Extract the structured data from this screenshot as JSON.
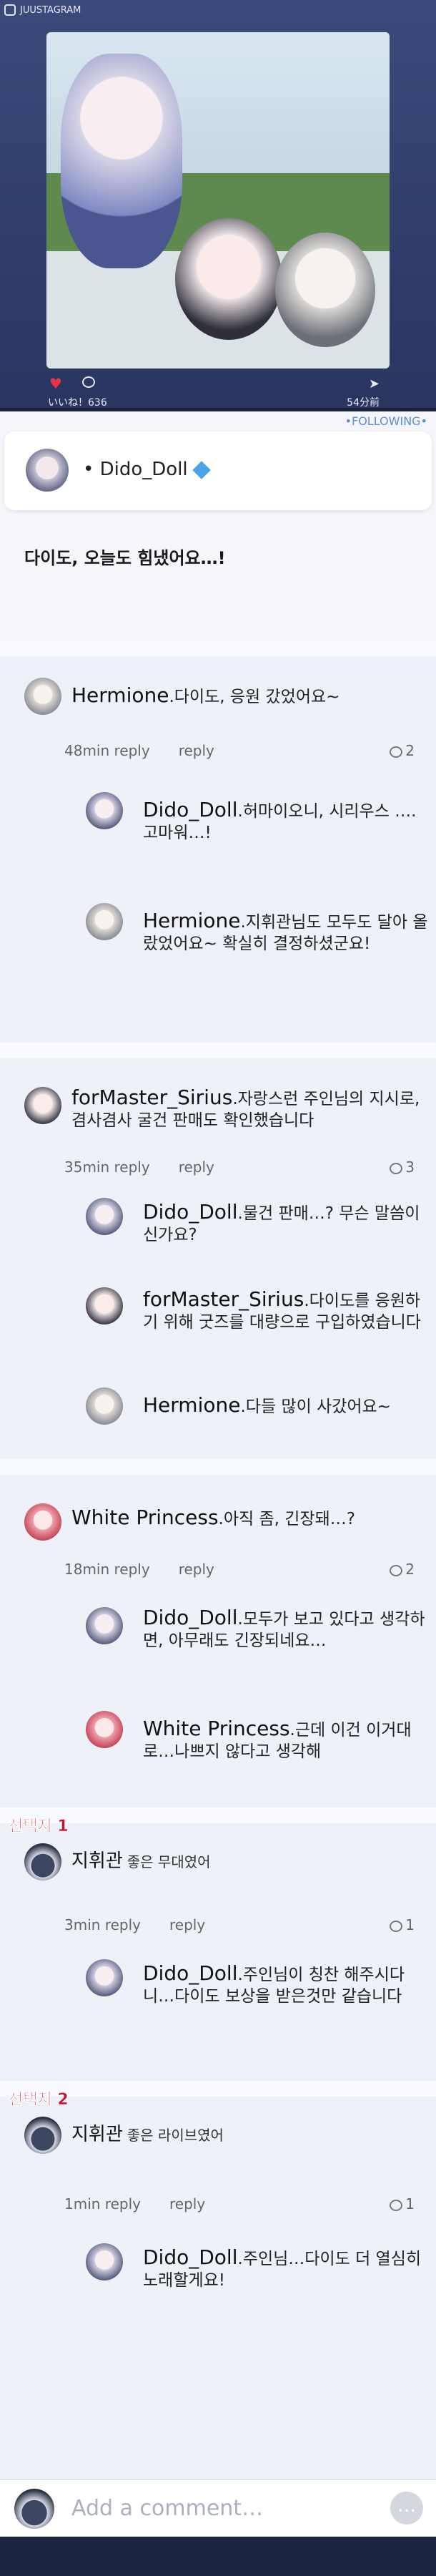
{
  "app": {
    "brand": "JUUSTAGRAM"
  },
  "post": {
    "likes": "いいね！636",
    "time": "54分前",
    "following": "•FOLLOWING•",
    "author": "Dido_Doll",
    "caption": "다이도, 오늘도 힘냈어요…!"
  },
  "threads": [
    {
      "author": "Hermione",
      "text": "다이도, 응원 갔었어요~",
      "time": "48min reply",
      "reply": "reply",
      "count": "2",
      "replies": [
        {
          "author": "Dido_Doll",
          "text": "허마이오니, 시리우스 ….고마워…!"
        },
        {
          "author": "Hermione",
          "text": "지휘관님도 모두도 달아 올랐었어요~ 확실히 결정하셨군요!"
        }
      ]
    },
    {
      "author": "forMaster_Sirius",
      "text": "자랑스런 주인님의 지시로, 겸사겸사 굴건 판매도 확인했습니다",
      "time": "35min reply",
      "reply": "reply",
      "count": "3",
      "replies": [
        {
          "author": "Dido_Doll",
          "text": "물건 판매…? 무슨 말씀이신가요?"
        },
        {
          "author": "forMaster_Sirius",
          "text": "다이도를 응원하기 위해 굿즈를 대량으로 구입하였습니다"
        },
        {
          "author": "Hermione",
          "text": "다들 많이 사갔어요~"
        }
      ]
    },
    {
      "author": "White Princess",
      "text": "아직 좀, 긴장돼…?",
      "time": "18min reply",
      "reply": "reply",
      "count": "2",
      "replies": [
        {
          "author": "Dido_Doll",
          "text": "모두가 보고 있다고 생각하면, 아무래도 긴장되네요…"
        },
        {
          "author": "White Princess",
          "text": "근데 이건 이거대로…나쁘지 않다고 생각해"
        }
      ]
    }
  ],
  "choices": [
    {
      "label": "선택지 1",
      "author": "지휘관",
      "text": "좋은 무대였어",
      "time": "3min reply",
      "reply": "reply",
      "count": "1",
      "reply_author": "Dido_Doll",
      "reply_text": "주인님이 칭찬 해주시다니…다이도 보상을 받은것만 같습니다"
    },
    {
      "label": "선택지 2",
      "author": "지휘관",
      "text": "좋은 라이브였어",
      "time": "1min reply",
      "reply": "reply",
      "count": "1",
      "reply_author": "Dido_Doll",
      "reply_text": "주인님…다이도 더 열심히 노래할게요!"
    }
  ],
  "composer": {
    "placeholder": "Add a comment…",
    "more": "…"
  },
  "colors": {
    "accent": "#5a8fd8",
    "choice": "#c8102e",
    "like": "#e8324a"
  }
}
